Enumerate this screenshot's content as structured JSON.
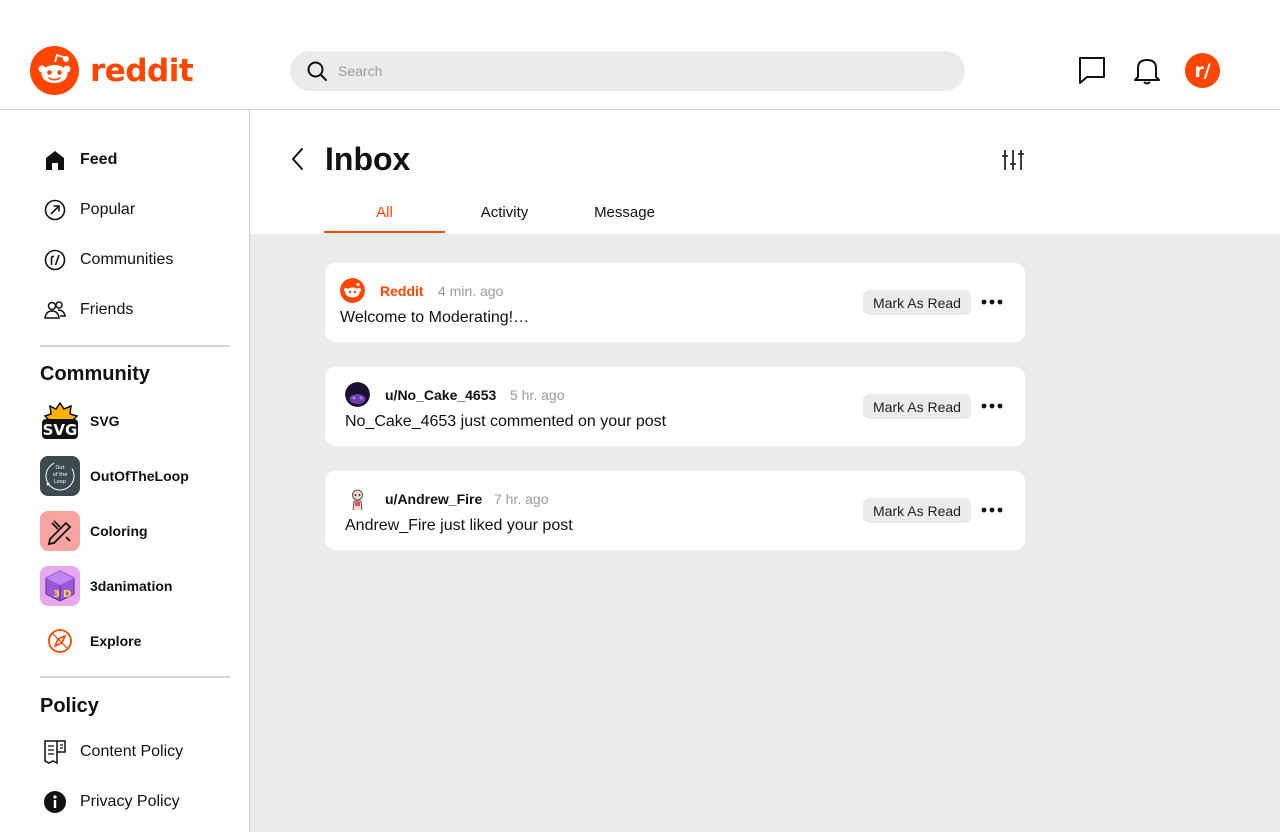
{
  "header": {
    "logo_text": "reddit",
    "search_placeholder": "Search",
    "avatar_text": "r/"
  },
  "sidebar": {
    "nav": [
      {
        "label": "Feed",
        "icon": "home-icon"
      },
      {
        "label": "Popular",
        "icon": "popular-icon"
      },
      {
        "label": "Communities",
        "icon": "communities-icon"
      },
      {
        "label": "Friends",
        "icon": "friends-icon"
      }
    ],
    "community_title": "Community",
    "communities": [
      {
        "label": "SVG",
        "icon": "svg-community-icon"
      },
      {
        "label": "OutOfTheLoop",
        "icon": "outoftheloop-community-icon",
        "icon_text": "Out of the Loop"
      },
      {
        "label": "Coloring",
        "icon": "coloring-community-icon"
      },
      {
        "label": "3danimation",
        "icon": "3danimation-community-icon"
      },
      {
        "label": "Explore",
        "icon": "explore-icon"
      }
    ],
    "policy_title": "Policy",
    "policies": [
      {
        "label": "Content Policy",
        "icon": "content-policy-icon"
      },
      {
        "label": "Privacy Policy",
        "icon": "info-icon"
      }
    ]
  },
  "inbox": {
    "title": "Inbox",
    "tabs": [
      "All",
      "Activity",
      "Message"
    ],
    "active_tab": "All",
    "mark_label": "Mark As Read",
    "notifications": [
      {
        "name": "Reddit",
        "time": "4 min. ago",
        "body": "Welcome to Moderating!…"
      },
      {
        "name": "u/No_Cake_4653",
        "time": "5 hr. ago",
        "body": "No_Cake_4653 just commented on your post"
      },
      {
        "name": "u/Andrew_Fire",
        "time": "7 hr. ago",
        "body": "Andrew_Fire just liked your post"
      }
    ]
  },
  "colors": {
    "brand": "#ff4500",
    "background": "#ebebeb"
  }
}
